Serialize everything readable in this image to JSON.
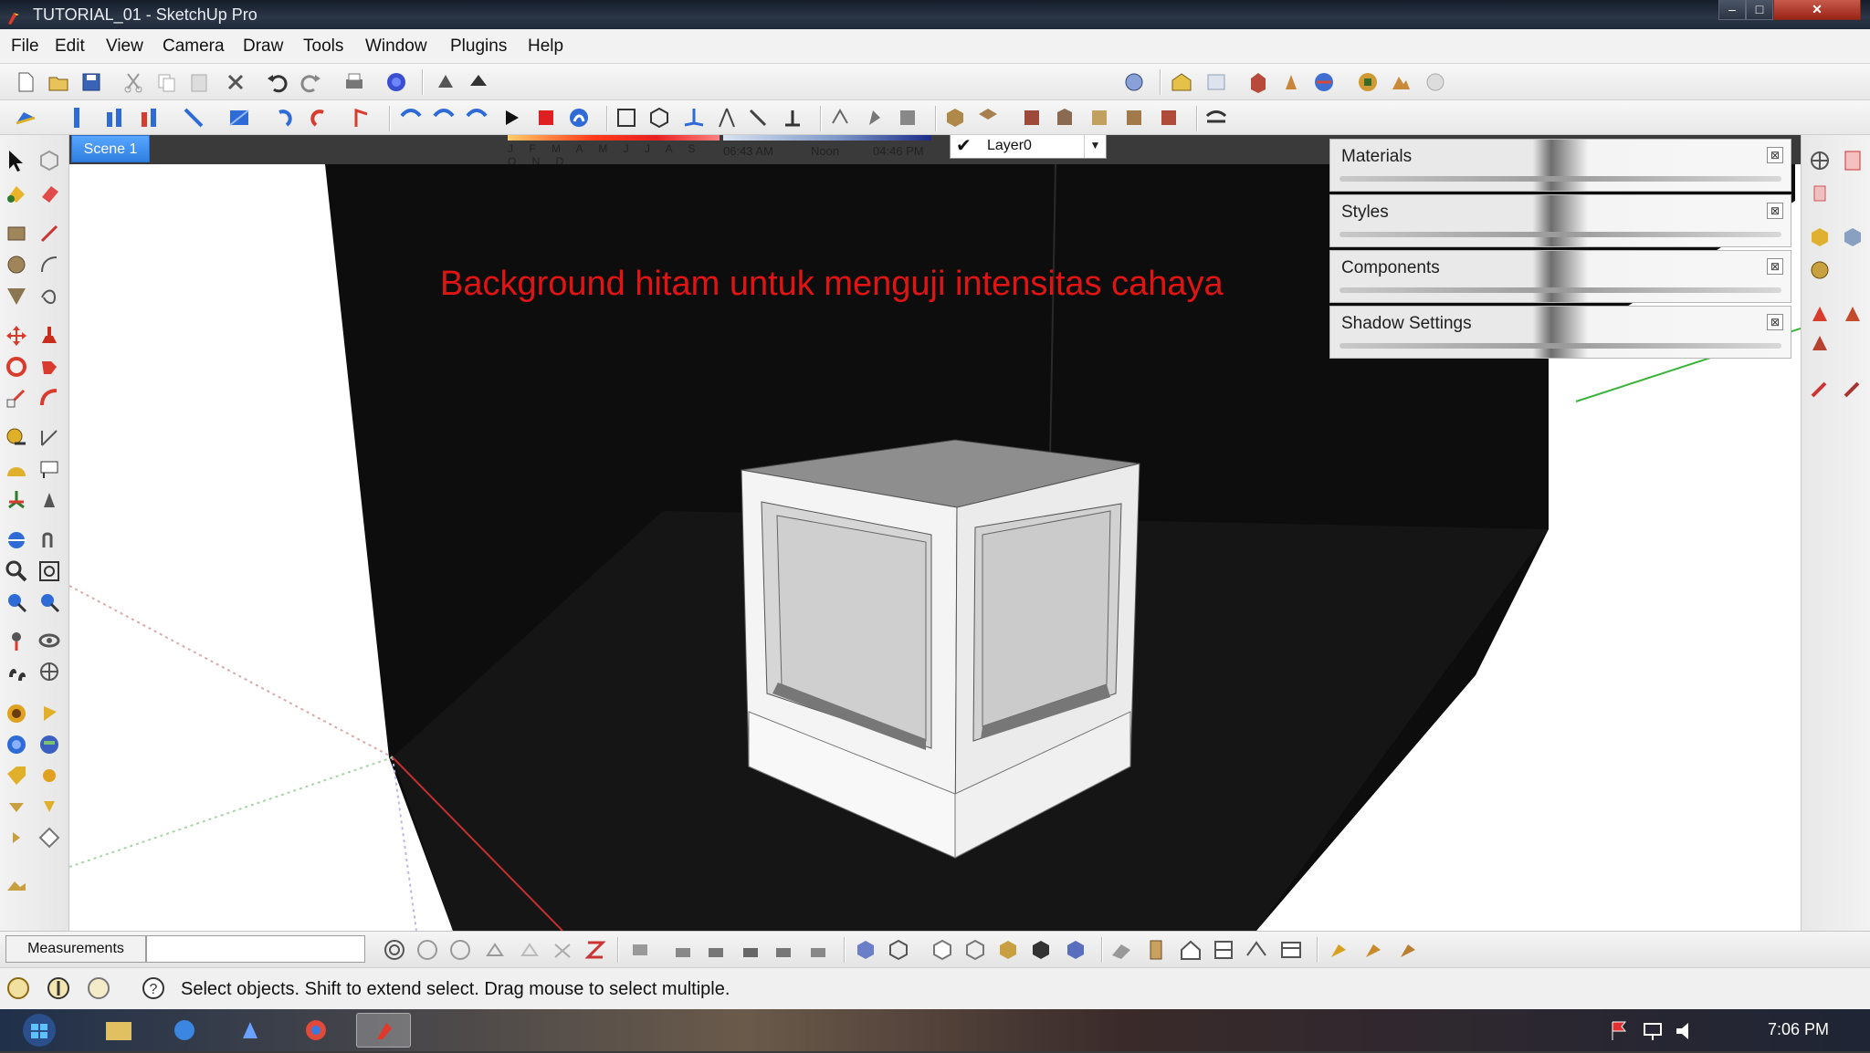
{
  "window": {
    "title": "TUTORIAL_01 - SketchUp Pro",
    "controls": {
      "min": "–",
      "max": "□",
      "close": "✕"
    }
  },
  "menu": [
    "File",
    "Edit",
    "View",
    "Camera",
    "Draw",
    "Tools",
    "Window",
    "Plugins",
    "Help"
  ],
  "shadow": {
    "months": "J F M A M J J A S O N D",
    "time_left": "06:43 AM",
    "time_mid": "Noon",
    "time_right": "04:46 PM"
  },
  "layer": {
    "check": "✔",
    "name": "Layer0",
    "arrow": "▼"
  },
  "scene_tab": "Scene 1",
  "viewport": {
    "annotation": "Background hitam untuk menguji intensitas cahaya",
    "annotation_color": "#e11414",
    "backdrop_color": "#0d0d0d"
  },
  "trays": [
    {
      "label": "Materials",
      "close": "⊠"
    },
    {
      "label": "Styles",
      "close": "⊠"
    },
    {
      "label": "Components",
      "close": "⊠"
    },
    {
      "label": "Shadow Settings",
      "close": "⊠"
    }
  ],
  "bottom": {
    "measurements_label": "Measurements"
  },
  "status": {
    "text": "Select objects. Shift to extend select. Drag mouse to select multiple."
  },
  "taskbar": {
    "clock": "7:06 PM"
  },
  "icons": {
    "toolbar1": [
      "new-icon",
      "open-icon",
      "save-icon",
      "cut-icon",
      "copy-icon",
      "paste-icon",
      "erase-icon",
      "undo-icon",
      "redo-icon",
      "print-icon",
      "model-info-icon",
      "shadow-toggle-icon",
      "fog-icon"
    ],
    "toolbar1_right": [
      "layer-manager-icon",
      "warehouse-icon",
      "share-model-icon",
      "component-icon",
      "pin-icon",
      "google-earth-icon",
      "geo-icon",
      "toggle-terrain-icon",
      "photo-texture-icon"
    ]
  }
}
